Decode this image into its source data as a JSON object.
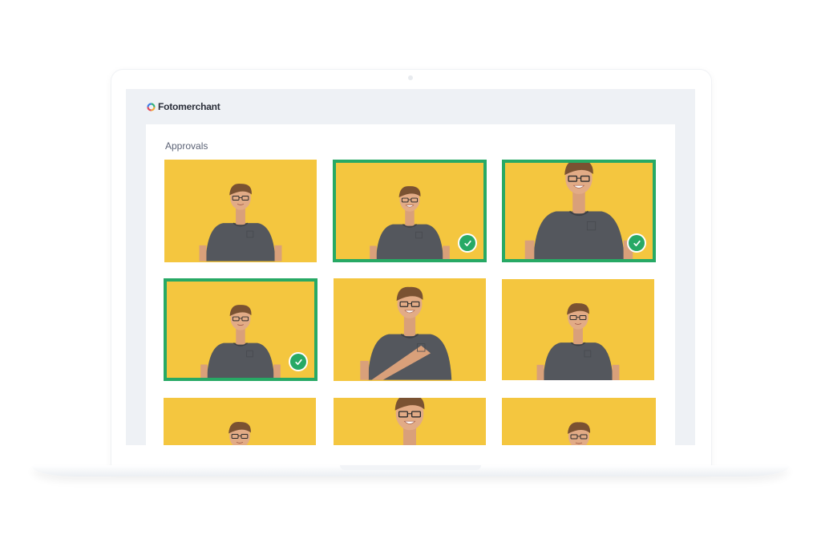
{
  "app": {
    "logo_text": "Fotomerchant"
  },
  "page": {
    "section_title": "Approvals"
  },
  "photos": [
    {
      "approved": false,
      "pose": "standing"
    },
    {
      "approved": true,
      "pose": "smile"
    },
    {
      "approved": true,
      "pose": "closeup"
    },
    {
      "approved": true,
      "pose": "standing"
    },
    {
      "approved": false,
      "pose": "laugh"
    },
    {
      "approved": false,
      "pose": "standing"
    },
    {
      "approved": false,
      "pose": "standing"
    },
    {
      "approved": false,
      "pose": "closeup"
    },
    {
      "approved": false,
      "pose": "standing"
    }
  ],
  "colors": {
    "accent": "#27a965",
    "photo_background": "#f4c63f",
    "screen_background": "#eef1f5"
  }
}
